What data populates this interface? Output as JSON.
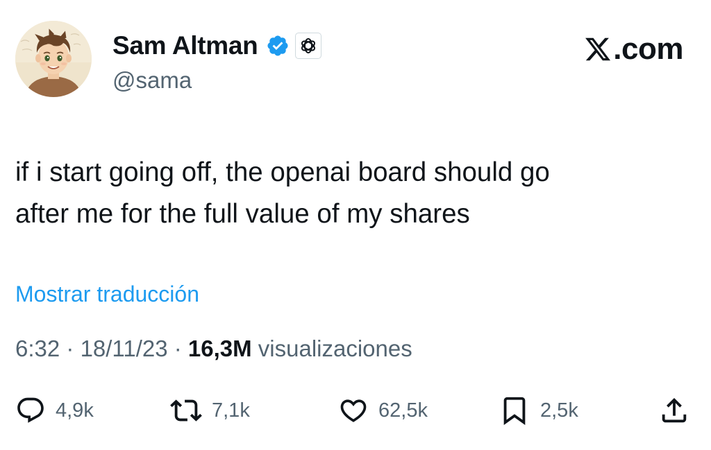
{
  "author": {
    "display_name": "Sam Altman",
    "handle": "@sama",
    "verified_icon": "verified-badge-icon",
    "affiliate_icon": "openai-logo-icon",
    "avatar": "avatar-illustration"
  },
  "brand": {
    "logo_icon": "x-logo-icon",
    "label": ".com"
  },
  "tweet": {
    "text_line1": "if i start going off, the openai board should go",
    "text_line2": "after me for the full value of my shares",
    "translate_label": "Mostrar traducción"
  },
  "meta": {
    "time": "6:32",
    "separator1": " · ",
    "date": "18/11/23",
    "separator2": " · ",
    "views_count": "16,3M",
    "views_label": " visualizaciones"
  },
  "actions": {
    "reply": {
      "icon": "reply-icon",
      "count": "4,9k"
    },
    "repost": {
      "icon": "repost-icon",
      "count": "7,1k"
    },
    "like": {
      "icon": "heart-icon",
      "count": "62,5k"
    },
    "bookmark": {
      "icon": "bookmark-icon",
      "count": "2,5k"
    },
    "share": {
      "icon": "share-icon"
    }
  },
  "colors": {
    "text": "#0f1419",
    "secondary": "#536471",
    "link": "#1d9bf0",
    "verified": "#1d9bf0"
  }
}
